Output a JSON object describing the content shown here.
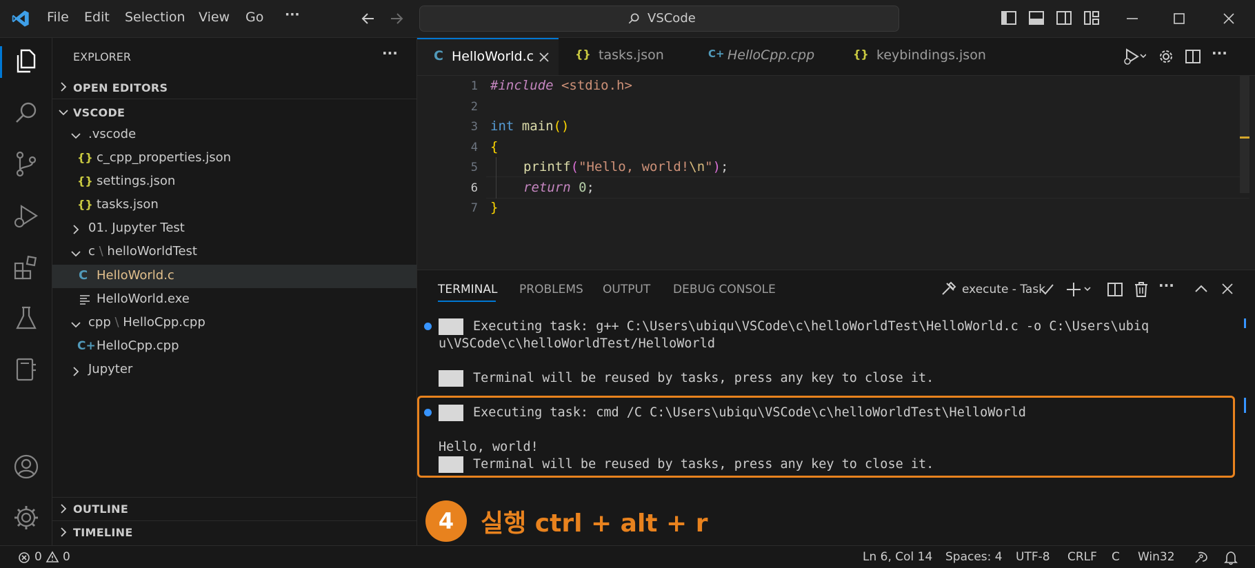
{
  "menu": {
    "file": "File",
    "edit": "Edit",
    "selection": "Selection",
    "view": "View",
    "go": "Go",
    "more": "···"
  },
  "command_center": {
    "text": "VSCode"
  },
  "sidebar": {
    "title": "EXPLORER",
    "open_editors": "OPEN EDITORS",
    "root": "VSCODE",
    "items": [
      ".vscode",
      "c_cpp_properties.json",
      "settings.json",
      "tasks.json",
      "01. Jupyter Test",
      "c",
      "helloWorldTest",
      "HelloWorld.c",
      "HelloWorld.exe",
      "cpp",
      "HelloCpp.cpp",
      "HelloCpp.cpp",
      "Jupyter"
    ],
    "outline": "OUTLINE",
    "timeline": "TIMELINE"
  },
  "tabs": [
    {
      "label": "HelloWorld.c",
      "icon": "C"
    },
    {
      "label": "tasks.json",
      "icon": "{}"
    },
    {
      "label": "HelloCpp.cpp",
      "icon": "C+"
    },
    {
      "label": "keybindings.json",
      "icon": "{}"
    }
  ],
  "code": {
    "line_numbers": [
      "1",
      "2",
      "3",
      "4",
      "5",
      "6",
      "7"
    ],
    "l1a": "#include",
    "l1b": " <stdio.h>",
    "l3a": "int",
    "l3b": " main",
    "l3c": "()",
    "l4": "{",
    "l5a": "printf",
    "l5b": "(",
    "l5c": "\"Hello, world!",
    "l5d": "\\n",
    "l5e": "\"",
    "l5f": ")",
    "l5g": ";",
    "l6a": "return",
    "l6b": " ",
    "l6c": "0",
    "l6d": ";",
    "l7": "}"
  },
  "panel": {
    "tabs": [
      "TERMINAL",
      "PROBLEMS",
      "OUTPUT",
      "DEBUG CONSOLE"
    ],
    "task_label": "execute - Task",
    "lines": [
      "Executing task: g++ C:\\Users\\ubiqu\\VSCode\\c\\helloWorldTest\\HelloWorld.c -o C:\\Users\\ubiq",
      "u\\VSCode\\c\\helloWorldTest/HelloWorld",
      "Terminal will be reused by tasks, press any key to close it.",
      "Executing task: cmd /C C:\\Users\\ubiqu\\VSCode\\c\\helloWorldTest\\HelloWorld",
      "Hello, world!",
      "Terminal will be reused by tasks, press any key to close it."
    ]
  },
  "annotation": {
    "number": "4",
    "text": "실행 ctrl + alt + r",
    "color": "#e8821e"
  },
  "statusbar": {
    "errors": "0",
    "warnings": "0",
    "position": "Ln 6, Col 14",
    "spaces": "Spaces: 4",
    "encoding": "UTF-8",
    "eol": "CRLF",
    "language": "C",
    "platform": "Win32"
  },
  "colors": {
    "accent": "#0078d4",
    "keyword": "#569cd6",
    "control": "#c586c0",
    "function": "#dcdcaa",
    "string": "#ce9178",
    "number": "#b5cea8",
    "bracket": "#ffd700",
    "bracket2": "#da70d6",
    "include": "#c586c0",
    "json": "#cbcb41"
  }
}
